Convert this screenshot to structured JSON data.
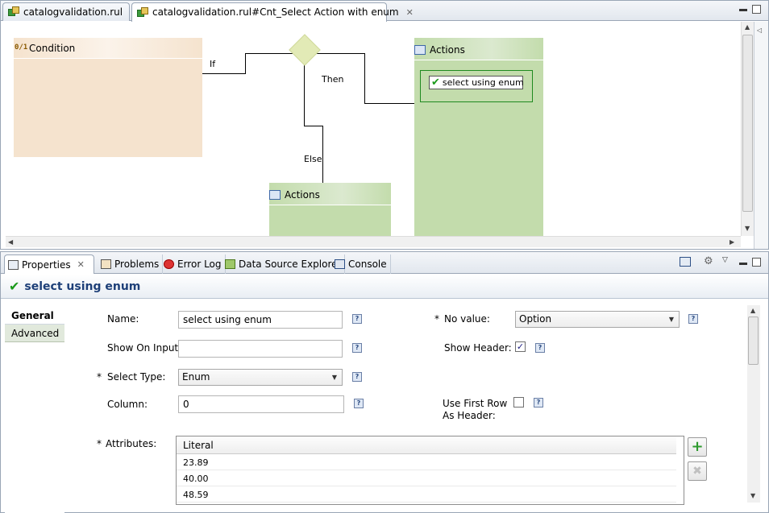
{
  "editor": {
    "tabs": [
      {
        "label": "catalogvalidation.rul",
        "active": false
      },
      {
        "label": "catalogvalidation.rul#Cnt_Select Action with enum",
        "active": true
      }
    ],
    "diagram": {
      "condition_label": "Condition",
      "condition_icon": "0/1",
      "if_label": "If",
      "then_label": "Then",
      "else_label": "Else",
      "then_actions_label": "Actions",
      "else_actions_label": "Actions",
      "action_item_label": "select using enum"
    }
  },
  "properties": {
    "tabs": [
      {
        "label": "Properties",
        "icon": "properties-icon",
        "active": true
      },
      {
        "label": "Problems",
        "icon": "problems-icon"
      },
      {
        "label": "Error Log",
        "icon": "error-log-icon"
      },
      {
        "label": "Data Source Explorer",
        "icon": "data-source-icon"
      },
      {
        "label": "Console",
        "icon": "console-icon"
      }
    ],
    "title": "select using enum",
    "side_tabs": [
      {
        "label": "General",
        "active": true
      },
      {
        "label": "Advanced",
        "active": false
      }
    ],
    "form": {
      "name_label": "Name:",
      "name_value": "select using enum",
      "show_on_input_label": "Show On Input:",
      "show_on_input_value": "",
      "select_type_label": "Select Type:",
      "select_type_value": "Enum",
      "column_label": "Column:",
      "column_value": "0",
      "no_value_label": "No value:",
      "no_value_value": "Option",
      "show_header_label": "Show Header:",
      "show_header_checked": true,
      "use_first_row_label_1": "Use First Row",
      "use_first_row_label_2": "As Header:",
      "use_first_row_checked": false,
      "attributes_label": "Attributes:",
      "required_marker": "*",
      "help_glyph": "?"
    },
    "attributes_table": {
      "header": "Literal",
      "rows": [
        "23.89",
        "40.00",
        "48.59"
      ]
    },
    "colors": {
      "condition_fill": "#f5e3ce",
      "actions_fill": "#c3dcac",
      "diamond_fill": "#e2eab6",
      "title_color": "#1d3f78",
      "check_green": "#1b9a1b"
    }
  }
}
